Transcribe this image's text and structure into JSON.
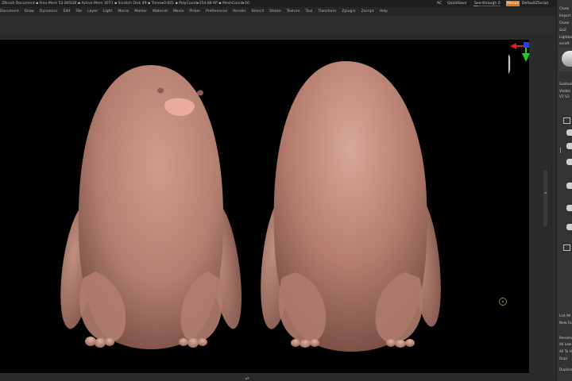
{
  "status_bar": {
    "text": "ZBrush Document   ▪ Free Mem 52.865GB ▪ Active Mem 3071 ▪ Scratch Disk 49 ▪ Timer▸0.001 ▪ PolyCount▸154.88 KP ▪ MeshCount▸16",
    "lightbox_label": "AC",
    "quicksave_label": "QuickSave",
    "seethrough_label": "See-through  0",
    "menus_label": "Menus",
    "defaultzscript_label": "DefaultZScript"
  },
  "menu_bar": {
    "items": [
      "Document",
      "Draw",
      "Dynamics",
      "Edit",
      "File",
      "Layer",
      "Light",
      "Macro",
      "Marker",
      "Material",
      "Movie",
      "Picker",
      "Preferences",
      "Render",
      "Stencil",
      "Stroke",
      "Texture",
      "Tool",
      "Transform",
      "Zplugin",
      "Zscript",
      "Help"
    ]
  },
  "right_tray": {
    "items": [
      "Clone",
      "Import",
      "Clone",
      "GoZ",
      "Lightbox",
      "ecraft",
      "Subtool",
      "Visible",
      "V1  V2",
      "List All",
      "New Fo",
      "Rename",
      "All Low",
      "All To H",
      "Dupl",
      "Duplicat"
    ]
  },
  "viewport": {
    "bottom_handle": "▴▾",
    "side_handle": "◂▸"
  },
  "colors": {
    "accent": "#e07b22",
    "canvas_bg": "#000000",
    "clay": "#c08a7a",
    "beak": "#e6a79b",
    "gyro_red": "#e02020",
    "gyro_green": "#20d020",
    "gyro_blue": "#2040ff"
  },
  "icons": [
    "head-gyro-icon",
    "target-icon",
    "subtool-brush-icon"
  ]
}
